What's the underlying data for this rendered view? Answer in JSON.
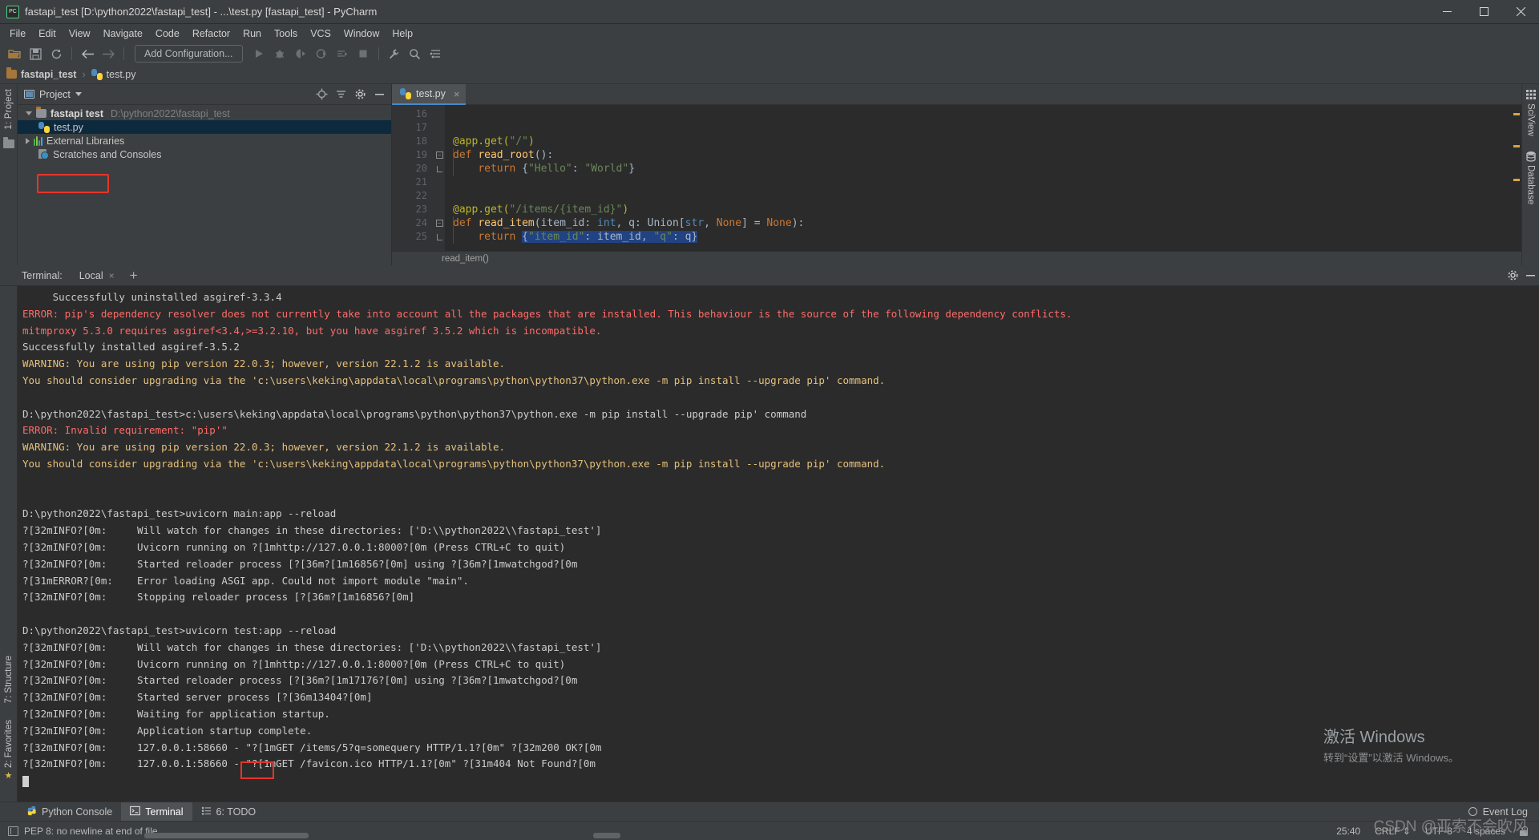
{
  "window": {
    "title": "fastapi_test [D:\\python2022\\fastapi_test] - ...\\test.py [fastapi_test] - PyCharm",
    "app_icon": "pycharm-icon",
    "minimize_label": "Minimize",
    "maximize_label": "Maximize",
    "close_label": "Close"
  },
  "menubar": {
    "items": [
      {
        "label": "File"
      },
      {
        "label": "Edit"
      },
      {
        "label": "View"
      },
      {
        "label": "Navigate"
      },
      {
        "label": "Code"
      },
      {
        "label": "Refactor"
      },
      {
        "label": "Run"
      },
      {
        "label": "Tools"
      },
      {
        "label": "VCS"
      },
      {
        "label": "Window"
      },
      {
        "label": "Help"
      }
    ]
  },
  "toolbar": {
    "add_configuration_label": "Add Configuration...",
    "icons": [
      {
        "name": "open-folder-icon"
      },
      {
        "name": "save-icon"
      },
      {
        "name": "sync-icon"
      },
      {
        "name": "back-arrow-icon"
      },
      {
        "name": "forward-arrow-icon"
      },
      {
        "name": "run-icon"
      },
      {
        "name": "debug-icon"
      },
      {
        "name": "run-coverage-icon"
      },
      {
        "name": "profile-icon"
      },
      {
        "name": "run-with-console-icon"
      },
      {
        "name": "stop-icon"
      },
      {
        "name": "settings-wrench-icon"
      },
      {
        "name": "search-icon"
      },
      {
        "name": "structure-icon"
      }
    ]
  },
  "navbar": {
    "project_crumb": "fastapi_test",
    "file_crumb": "test.py",
    "separator": "›"
  },
  "project_panel": {
    "title": "Project",
    "rail_label": "1: Project",
    "tree": [
      {
        "label": "fastapi test",
        "path": "D:\\python2022\\fastapi_test",
        "icon": "folder-icon",
        "expanded": true
      },
      {
        "label": "test.py",
        "path": "",
        "icon": "python-file-icon",
        "selected": true
      },
      {
        "label": "External Libraries",
        "path": "",
        "icon": "libraries-icon",
        "expanded": false
      },
      {
        "label": "Scratches and Consoles",
        "path": "",
        "icon": "scratches-icon"
      }
    ],
    "header_icons": [
      {
        "name": "locate-target-icon"
      },
      {
        "name": "collapse-all-icon"
      },
      {
        "name": "gear-icon"
      },
      {
        "name": "hide-panel-icon"
      }
    ]
  },
  "editor": {
    "tab_label": "test.py",
    "tab_close_label": "×",
    "breadcrumb": "read_item()",
    "first_line_number": 16,
    "lines": [
      {
        "n": 16,
        "tokens": []
      },
      {
        "n": 17,
        "tokens": []
      },
      {
        "n": 18,
        "tokens": [
          {
            "t": "@app.get(",
            "c": "dec"
          },
          {
            "t": "\"/\"",
            "c": "str"
          },
          {
            "t": ")",
            "c": "dec"
          }
        ]
      },
      {
        "n": 19,
        "tokens": [
          {
            "t": "def ",
            "c": "kw"
          },
          {
            "t": "read_root",
            "c": "fn"
          },
          {
            "t": "():",
            "c": "plain"
          }
        ],
        "fold": "start"
      },
      {
        "n": 20,
        "tokens": [
          {
            "t": "    ",
            "c": "plain"
          },
          {
            "t": "return ",
            "c": "kw"
          },
          {
            "t": "{",
            "c": "plain"
          },
          {
            "t": "\"Hello\"",
            "c": "str"
          },
          {
            "t": ": ",
            "c": "plain"
          },
          {
            "t": "\"World\"",
            "c": "str"
          },
          {
            "t": "}",
            "c": "plain"
          }
        ],
        "fold": "end"
      },
      {
        "n": 21,
        "tokens": []
      },
      {
        "n": 22,
        "tokens": []
      },
      {
        "n": 23,
        "tokens": [
          {
            "t": "@app.get(",
            "c": "dec"
          },
          {
            "t": "\"/items/{item_id}\"",
            "c": "str"
          },
          {
            "t": ")",
            "c": "dec"
          }
        ]
      },
      {
        "n": 24,
        "tokens": [
          {
            "t": "def ",
            "c": "kw"
          },
          {
            "t": "read_item",
            "c": "fn"
          },
          {
            "t": "(item_id: ",
            "c": "plain"
          },
          {
            "t": "int",
            "c": "type"
          },
          {
            "t": ", q: Union[",
            "c": "plain"
          },
          {
            "t": "str",
            "c": "type"
          },
          {
            "t": ", ",
            "c": "plain"
          },
          {
            "t": "None",
            "c": "kw"
          },
          {
            "t": "] = ",
            "c": "plain"
          },
          {
            "t": "None",
            "c": "kw"
          },
          {
            "t": "):",
            "c": "plain"
          }
        ],
        "fold": "start"
      },
      {
        "n": 25,
        "tokens": [
          {
            "t": "    ",
            "c": "plain"
          },
          {
            "t": "return ",
            "c": "kw"
          },
          {
            "t": "{",
            "c": "plain"
          },
          {
            "t": "\"item_id\"",
            "c": "str"
          },
          {
            "t": ": item_id, ",
            "c": "plain"
          },
          {
            "t": "\"q\"",
            "c": "str"
          },
          {
            "t": ": q}",
            "c": "plain"
          }
        ],
        "fold": "end"
      }
    ]
  },
  "terminal": {
    "label": "Terminal:",
    "tab_label": "Local",
    "tab_close_label": "×",
    "add_tab_label": "+",
    "settings_icon": "gear-icon",
    "hide_icon": "hide-panel-icon",
    "highlight_text": "main:",
    "lines": [
      {
        "text": "     Successfully uninstalled asgiref-3.3.4",
        "color": "default"
      },
      {
        "text": "ERROR: pip's dependency resolver does not currently take into account all the packages that are installed. This behaviour is the source of the following dependency conflicts.",
        "color": "red"
      },
      {
        "text": "mitmproxy 5.3.0 requires asgiref<3.4,>=3.2.10, but you have asgiref 3.5.2 which is incompatible.",
        "color": "red"
      },
      {
        "text": "Successfully installed asgiref-3.5.2",
        "color": "default"
      },
      {
        "text": "WARNING: You are using pip version 22.0.3; however, version 22.1.2 is available.",
        "color": "yellow"
      },
      {
        "text": "You should consider upgrading via the 'c:\\users\\keking\\appdata\\local\\programs\\python\\python37\\python.exe -m pip install --upgrade pip' command.",
        "color": "yellow"
      },
      {
        "text": "",
        "color": "default"
      },
      {
        "text": "D:\\python2022\\fastapi_test>c:\\users\\keking\\appdata\\local\\programs\\python\\python37\\python.exe -m pip install --upgrade pip' command",
        "color": "default"
      },
      {
        "text": "ERROR: Invalid requirement: \"pip'\"",
        "color": "red"
      },
      {
        "text": "WARNING: You are using pip version 22.0.3; however, version 22.1.2 is available.",
        "color": "yellow"
      },
      {
        "text": "You should consider upgrading via the 'c:\\users\\keking\\appdata\\local\\programs\\python\\python37\\python.exe -m pip install --upgrade pip' command.",
        "color": "yellow"
      },
      {
        "text": "",
        "color": "default"
      },
      {
        "text": "",
        "color": "default"
      },
      {
        "text": "D:\\python2022\\fastapi_test>uvicorn main:app --reload",
        "color": "default"
      },
      {
        "text": "?[32mINFO?[0m:     Will watch for changes in these directories: ['D:\\\\python2022\\\\fastapi_test']",
        "color": "default"
      },
      {
        "text": "?[32mINFO?[0m:     Uvicorn running on ?[1mhttp://127.0.0.1:8000?[0m (Press CTRL+C to quit)",
        "color": "default"
      },
      {
        "text": "?[32mINFO?[0m:     Started reloader process [?[36m?[1m16856?[0m] using ?[36m?[1mwatchgod?[0m",
        "color": "default"
      },
      {
        "text": "?[31mERROR?[0m:    Error loading ASGI app. Could not import module \"main\".",
        "color": "default"
      },
      {
        "text": "?[32mINFO?[0m:     Stopping reloader process [?[36m?[1m16856?[0m]",
        "color": "default"
      },
      {
        "text": "",
        "color": "default"
      },
      {
        "text": "D:\\python2022\\fastapi_test>uvicorn test:app --reload",
        "color": "default"
      },
      {
        "text": "?[32mINFO?[0m:     Will watch for changes in these directories: ['D:\\\\python2022\\\\fastapi_test']",
        "color": "default"
      },
      {
        "text": "?[32mINFO?[0m:     Uvicorn running on ?[1mhttp://127.0.0.1:8000?[0m (Press CTRL+C to quit)",
        "color": "default"
      },
      {
        "text": "?[32mINFO?[0m:     Started reloader process [?[36m?[1m17176?[0m] using ?[36m?[1mwatchgod?[0m",
        "color": "default"
      },
      {
        "text": "?[32mINFO?[0m:     Started server process [?[36m13404?[0m]",
        "color": "default"
      },
      {
        "text": "?[32mINFO?[0m:     Waiting for application startup.",
        "color": "default"
      },
      {
        "text": "?[32mINFO?[0m:     Application startup complete.",
        "color": "default"
      },
      {
        "text": "?[32mINFO?[0m:     127.0.0.1:58660 - \"?[1mGET /items/5?q=somequery HTTP/1.1?[0m\" ?[32m200 OK?[0m",
        "color": "default"
      },
      {
        "text": "?[32mINFO?[0m:     127.0.0.1:58660 - \"?[1mGET /favicon.ico HTTP/1.1?[0m\" ?[31m404 Not Found?[0m",
        "color": "default"
      }
    ]
  },
  "left_rails": {
    "favorites_label": "2: Favorites",
    "structure_label": "7: Structure"
  },
  "right_rails": {
    "sciview_label": "SciView",
    "database_label": "Database"
  },
  "bottom_bar": {
    "items": [
      {
        "label": "Python Console",
        "icon": "python-console-icon",
        "active": false
      },
      {
        "label": "Terminal",
        "icon": "terminal-icon",
        "active": true
      },
      {
        "label": "6: TODO",
        "icon": "todo-icon",
        "active": false
      }
    ],
    "event_log_label": "Event Log",
    "event_log_icon": "event-log-icon"
  },
  "statusbar": {
    "message": "PEP 8: no newline at end of file",
    "message_icon": "inspection-icon",
    "caret_position": "25:40",
    "line_separator": "CRLF",
    "encoding": "UTF-8",
    "indent": "4 spaces",
    "lock_icon": "lock-icon"
  },
  "watermarks": {
    "windows_title": "激活 Windows",
    "windows_sub": "转到“设置”以激活 Windows。",
    "csdn": "CSDN @亚索不会吹风"
  },
  "colors": {
    "accent": "#4a88c7",
    "error": "#ff6b68",
    "warning": "#e5c07b",
    "selection": "#0d293e",
    "highlight_box": "#e8342a"
  }
}
